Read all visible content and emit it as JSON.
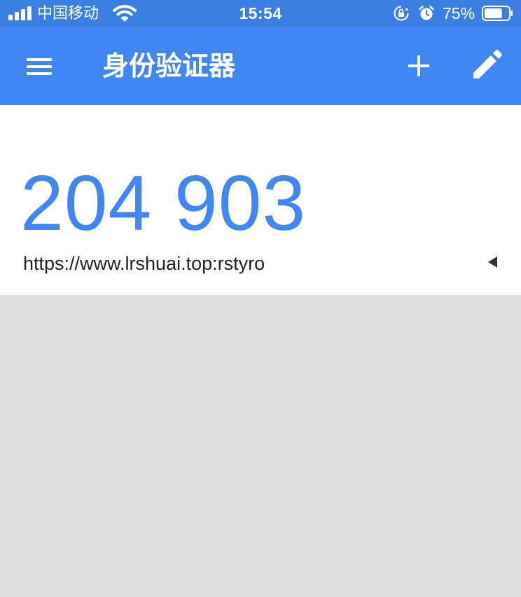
{
  "status_bar": {
    "carrier": "中国移动",
    "time": "15:54",
    "battery_percent": "75%",
    "battery_level": 0.75,
    "icons": [
      "signal-icon",
      "wifi-icon",
      "rotation-lock-icon",
      "alarm-icon",
      "battery-icon"
    ]
  },
  "app_bar": {
    "title": "身份验证器",
    "icons": [
      "menu-icon",
      "plus-icon",
      "pencil-icon"
    ]
  },
  "accounts": [
    {
      "code": "204 903",
      "label": "https://www.lrshuai.top:rstyro",
      "icon": "countdown-icon"
    }
  ],
  "colors": {
    "status_bar": "#3c7fe3",
    "app_bar": "#4285f4",
    "code": "#4285f4",
    "background": "#e0e0e0"
  }
}
